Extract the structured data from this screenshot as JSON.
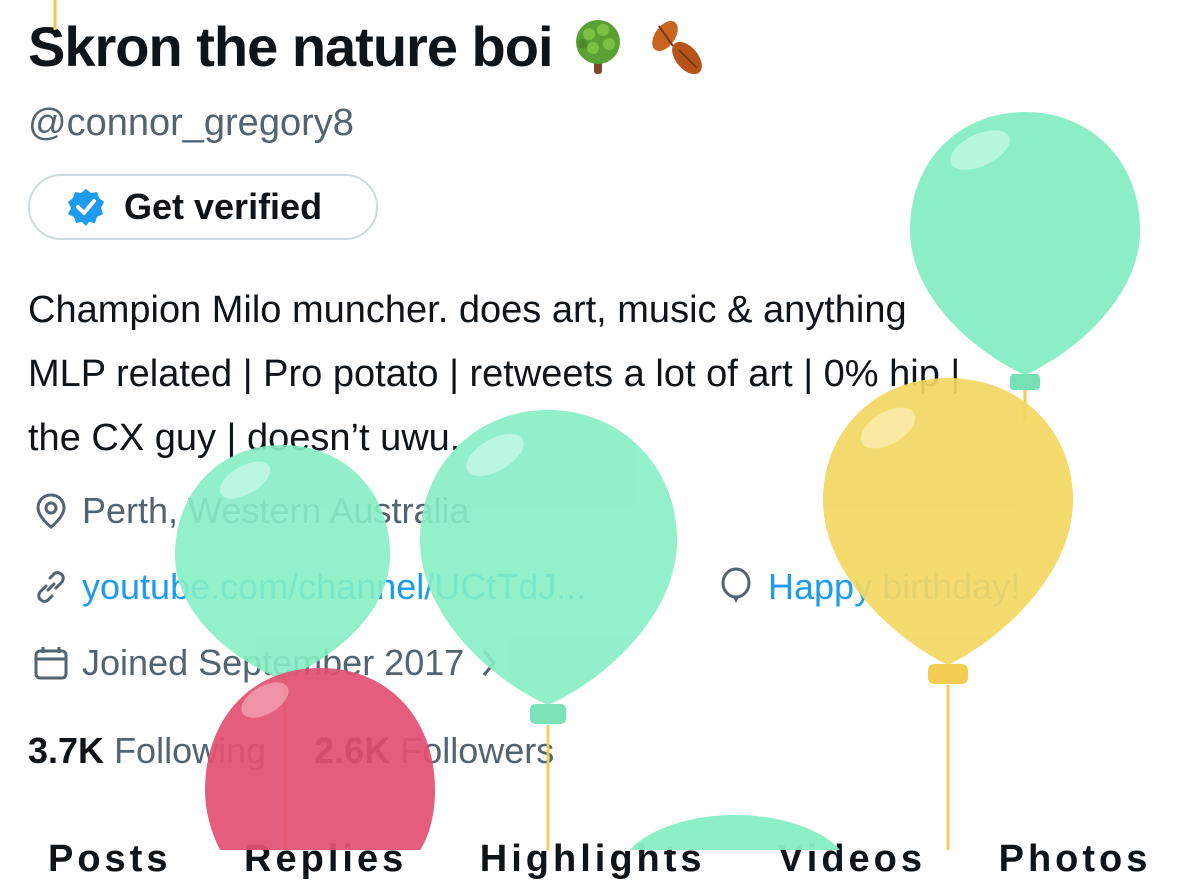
{
  "profile": {
    "display_name": "Skron the nature boi",
    "emoji_1": "tree-emoji",
    "emoji_2": "fallen-leaves-emoji",
    "handle": "@connor_gregory8",
    "verify_label": "Get verified",
    "bio_line_1": "Champion Milo muncher. does art, music & anything",
    "bio_line_2": "MLP related | Pro potato | retweets a lot of art | 0% hip |",
    "bio_line_3": "the CX guy | doesn’t uwu.",
    "location": "Perth, Western Australia",
    "website": "youtube.com/channel/UCtTdJ...",
    "birthday": "Happy birthday!",
    "joined": "Joined September 2017",
    "following_count": "3.7K",
    "following_label": "Following",
    "followers_count": "2.6K",
    "followers_label": "Followers"
  },
  "tabs": [
    "Posts",
    "Replies",
    "Highlights",
    "Videos",
    "Photos"
  ],
  "colors": {
    "link": "#1d9bf0",
    "secondary_text": "#536471",
    "balloon_green": "#86eec4",
    "balloon_yellow": "#f4d762",
    "balloon_red": "#e25174"
  }
}
